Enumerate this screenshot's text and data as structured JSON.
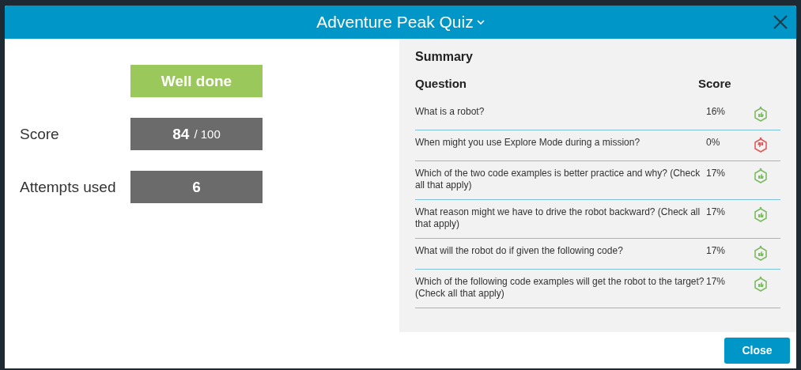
{
  "dialog": {
    "title": "Adventure Peak Quiz",
    "close_button": "Close"
  },
  "result": {
    "badge": "Well done",
    "stats": [
      {
        "label": "Score",
        "value": "84",
        "total": "/ 100"
      },
      {
        "label": "Attempts used",
        "value": "6"
      }
    ]
  },
  "summary": {
    "title": "Summary",
    "columns": [
      "Question",
      "Score"
    ],
    "rows": [
      {
        "question": "What is a robot?",
        "score": "16%",
        "correct": true
      },
      {
        "question": "When might you use Explore Mode during a mission?",
        "score": "0%",
        "correct": false
      },
      {
        "question": "Which of the two code examples is better practice and why? (Check all that apply)",
        "score": "17%",
        "correct": true
      },
      {
        "question": "What reason might we have to drive the robot backward? (Check all that apply)",
        "score": "17%",
        "correct": true
      },
      {
        "question": "What will the robot do if given the following code?",
        "score": "17%",
        "correct": true
      },
      {
        "question": "Which of the following code examples will get the robot to the target? (Check all that apply)",
        "score": "17%",
        "correct": true
      }
    ]
  }
}
